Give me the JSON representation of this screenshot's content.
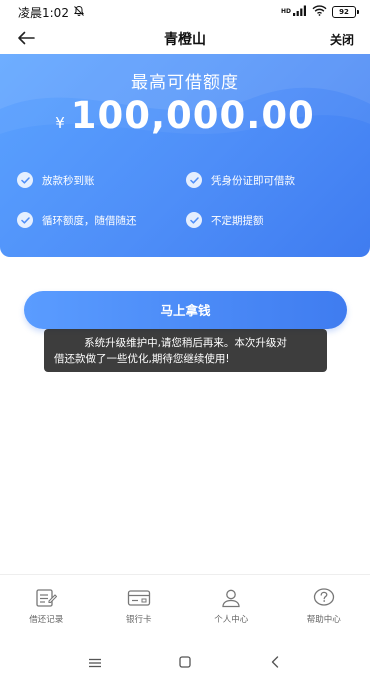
{
  "status_bar": {
    "time": "凌晨1:02",
    "network_badge": "HD",
    "battery": "92"
  },
  "header": {
    "title": "青橙山",
    "close_label": "关闭"
  },
  "hero": {
    "label": "最高可借额度",
    "currency": "¥",
    "amount": "100,000.00",
    "features": [
      "放款秒到账",
      "凭身份证即可借款",
      "循环额度，随借随还",
      "不定期提额"
    ]
  },
  "main_button": {
    "label": "马上拿钱"
  },
  "toast": {
    "line1": "系统升级维护中,请您稍后再来。本次升级对",
    "line2": "借还款做了一些优化,期待您继续使用!"
  },
  "bottom_nav": {
    "items": [
      {
        "label": "借还记录",
        "icon": "record-icon"
      },
      {
        "label": "银行卡",
        "icon": "bank-card-icon"
      },
      {
        "label": "个人中心",
        "icon": "user-icon"
      },
      {
        "label": "帮助中心",
        "icon": "help-icon"
      }
    ]
  },
  "colors": {
    "primary": "#4e8ef8",
    "primary_dark": "#3f7cf0",
    "toast_bg": "#222222"
  }
}
